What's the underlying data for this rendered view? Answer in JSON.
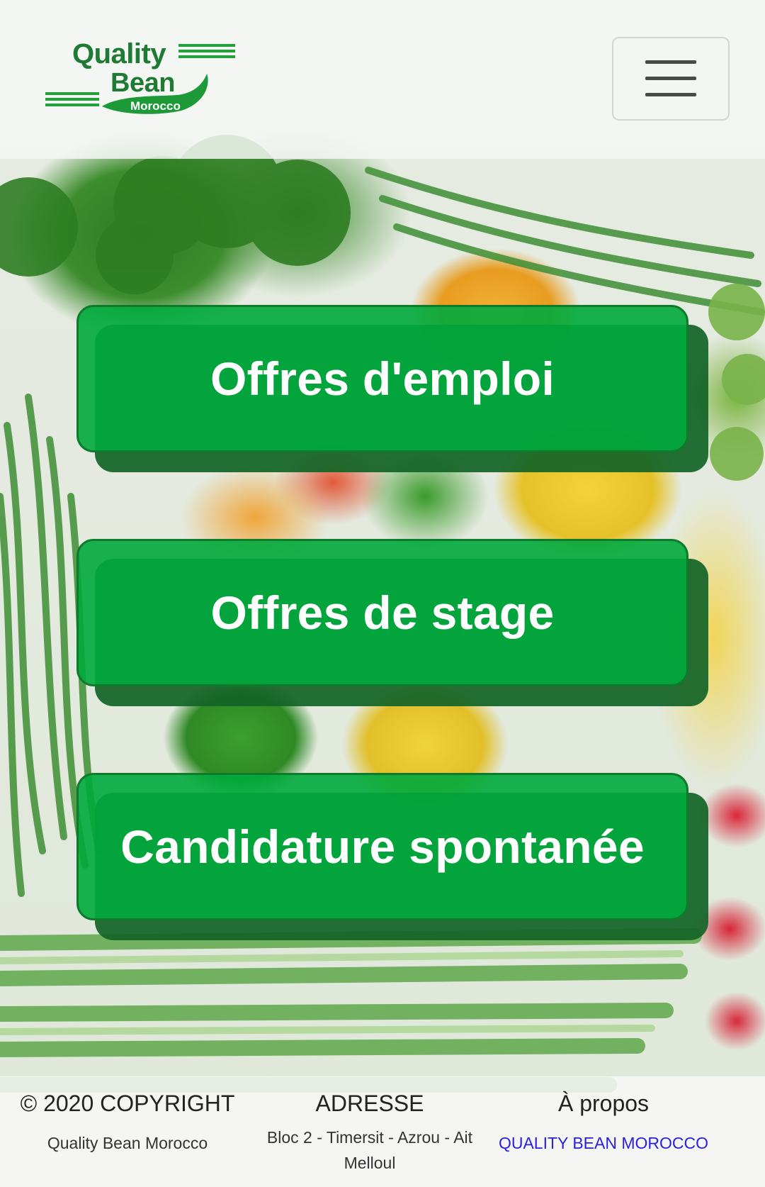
{
  "header": {
    "logo": {
      "word1": "Quality",
      "word2": "Bean",
      "word3": "Morocco"
    },
    "menu_icon": "hamburger-menu-icon"
  },
  "actions": [
    {
      "label": "Offres d'emploi"
    },
    {
      "label": "Offres de stage"
    },
    {
      "label": "Candidature spontanée"
    }
  ],
  "footer": {
    "copyright": {
      "heading": "© 2020 COPYRIGHT",
      "text": "Quality Bean Morocco"
    },
    "address": {
      "heading": "ADRESSE",
      "line1": "Bloc 2 - Timersit - Azrou - Ait",
      "line2": "Melloul"
    },
    "about": {
      "heading": "À propos",
      "link": "QUALITY BEAN MOROCCO"
    }
  },
  "colors": {
    "button_green": "#00aa3c",
    "button_shadow": "#146428",
    "logo_green": "#1f7a34",
    "link_blue": "#2a1fe0"
  }
}
